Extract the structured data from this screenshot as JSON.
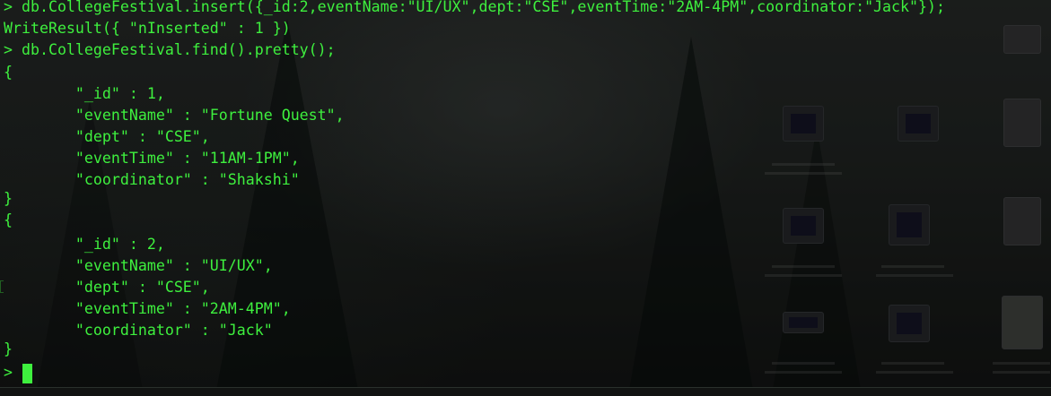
{
  "terminal": {
    "prompt": ">",
    "lines": [
      "> db.CollegeFestival.insert({_id:2,eventName:\"UI/UX\",dept:\"CSE\",eventTime:\"2AM-4PM\",coordinator:\"Jack\"});",
      "WriteResult({ \"nInserted\" : 1 })",
      "> db.CollegeFestival.find().pretty();",
      "{",
      "        \"_id\" : 1,",
      "        \"eventName\" : \"Fortune Quest\",",
      "        \"dept\" : \"CSE\",",
      "        \"eventTime\" : \"11AM-1PM\",",
      "        \"coordinator\" : \"Shakshi\"",
      "}",
      "{",
      "        \"_id\" : 2,",
      "        \"eventName\" : \"UI/UX\",",
      "        \"dept\" : \"CSE\",",
      "        \"eventTime\" : \"2AM-4PM\",",
      "        \"coordinator\" : \"Jack\"",
      "}",
      "> "
    ]
  },
  "colors": {
    "text": "#3ef03e",
    "cursor": "#3ef03e",
    "background": "#1b1e1c"
  }
}
